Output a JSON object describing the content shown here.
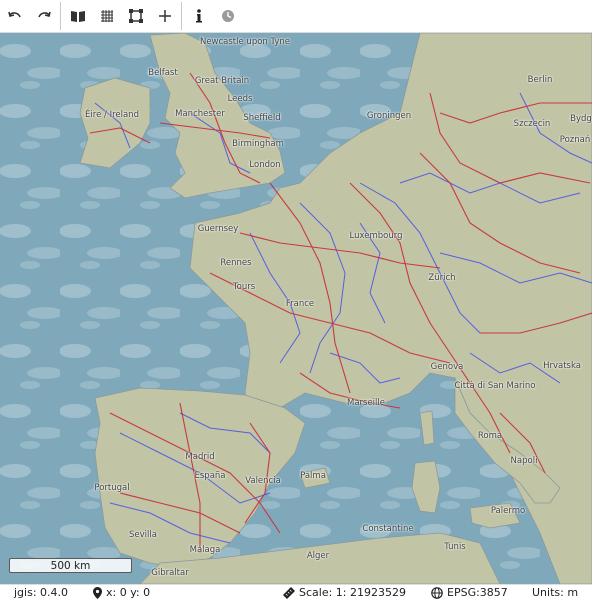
{
  "toolbar": {
    "icons": [
      "undo-icon",
      "redo-icon",
      "layers-book-icon",
      "grid-icon",
      "vector-shape-icon",
      "add-icon",
      "info-icon",
      "clock-icon"
    ]
  },
  "map": {
    "labels": [
      "Newcastle upon Tyne",
      "Belfast",
      "Great Britain",
      "Leeds",
      "Éire / Ireland",
      "Manchester",
      "Sheffield",
      "Birmingham",
      "London",
      "Groningen",
      "Berlin",
      "Szczecin",
      "Bydg",
      "Poznań",
      "Guernsey",
      "Luxembourg",
      "France",
      "Rennes",
      "Tours",
      "Zürich",
      "Hrvatska",
      "Genova",
      "Città di San Marino",
      "Marseille",
      "Roma",
      "Napoli",
      "Palermo",
      "Portugal",
      "Madrid",
      "España",
      "Valencia",
      "Palma",
      "Sevilla",
      "Málaga",
      "Gibraltar",
      "Alger",
      "Constantine",
      "Tunis"
    ],
    "colors": {
      "sea": "#7fa9bb",
      "land": "#c2c4a6",
      "roads": "#c8323c",
      "rivers": "#4a55e6"
    }
  },
  "scale_bar": {
    "label": "500 km"
  },
  "status": {
    "version": "jgis: 0.4.0",
    "coords": "x: 0 y: 0",
    "scale": "Scale: 1: 21923529",
    "epsg": "EPSG:3857",
    "units": "Units: m"
  }
}
